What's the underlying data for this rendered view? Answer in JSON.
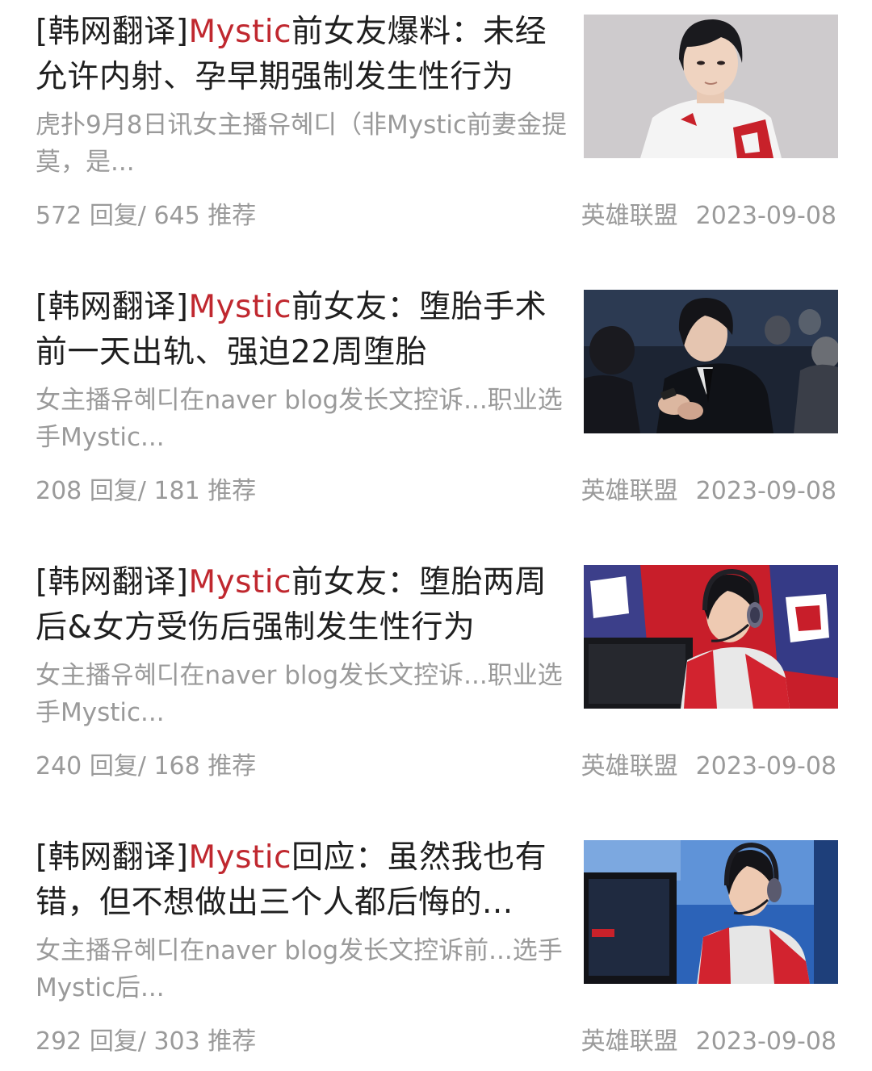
{
  "posts": [
    {
      "prefix": "[韩网翻译]",
      "highlight": "Mystic",
      "title_rest": "前女友爆料：未经允许内射、孕早期强制发生性行为",
      "snippet": "虎扑9月8日讯女主播유혜디（非Mystic前妻金提莫，是...",
      "replies": "572",
      "replies_label": "回复/",
      "recommends": "645",
      "recommends_label": "推荐",
      "category": "英雄联盟",
      "date": "2023-09-08",
      "thumbnail": "portrait-white-jersey"
    },
    {
      "prefix": "[韩网翻译]",
      "highlight": "Mystic",
      "title_rest": "前女友：堕胎手术前一天出轨、强迫22周堕胎",
      "snippet": "女主播유혜디在naver blog发长文控诉...职业选手Mystic...",
      "replies": "208",
      "replies_label": "回复/",
      "recommends": "181",
      "recommends_label": "推荐",
      "category": "英雄联盟",
      "date": "2023-09-08",
      "thumbnail": "suit-audience-phone"
    },
    {
      "prefix": "[韩网翻译]",
      "highlight": "Mystic",
      "title_rest": "前女友：堕胎两周后&女方受伤后强制发生性行为",
      "snippet": "女主播유혜디在naver blog发长文控诉...职业选手Mystic...",
      "replies": "240",
      "replies_label": "回复/",
      "recommends": "168",
      "recommends_label": "推荐",
      "category": "英雄联盟",
      "date": "2023-09-08",
      "thumbnail": "gamer-headset-red-chair"
    },
    {
      "prefix": "[韩网翻译]",
      "highlight": "Mystic",
      "title_rest": "回应：虽然我也有错，但不想做出三个人都后悔的...",
      "snippet": "女主播유혜디在naver blog发长文控诉前...选手Mystic后...",
      "replies": "292",
      "replies_label": "回复/",
      "recommends": "303",
      "recommends_label": "推荐",
      "category": "英雄联盟",
      "date": "2023-09-08",
      "thumbnail": "gamer-headset-blue-stage"
    }
  ],
  "colors": {
    "headline": "#1f1f1f",
    "highlight": "#c0282f",
    "secondary": "#9a9a9a",
    "background": "#ffffff"
  }
}
